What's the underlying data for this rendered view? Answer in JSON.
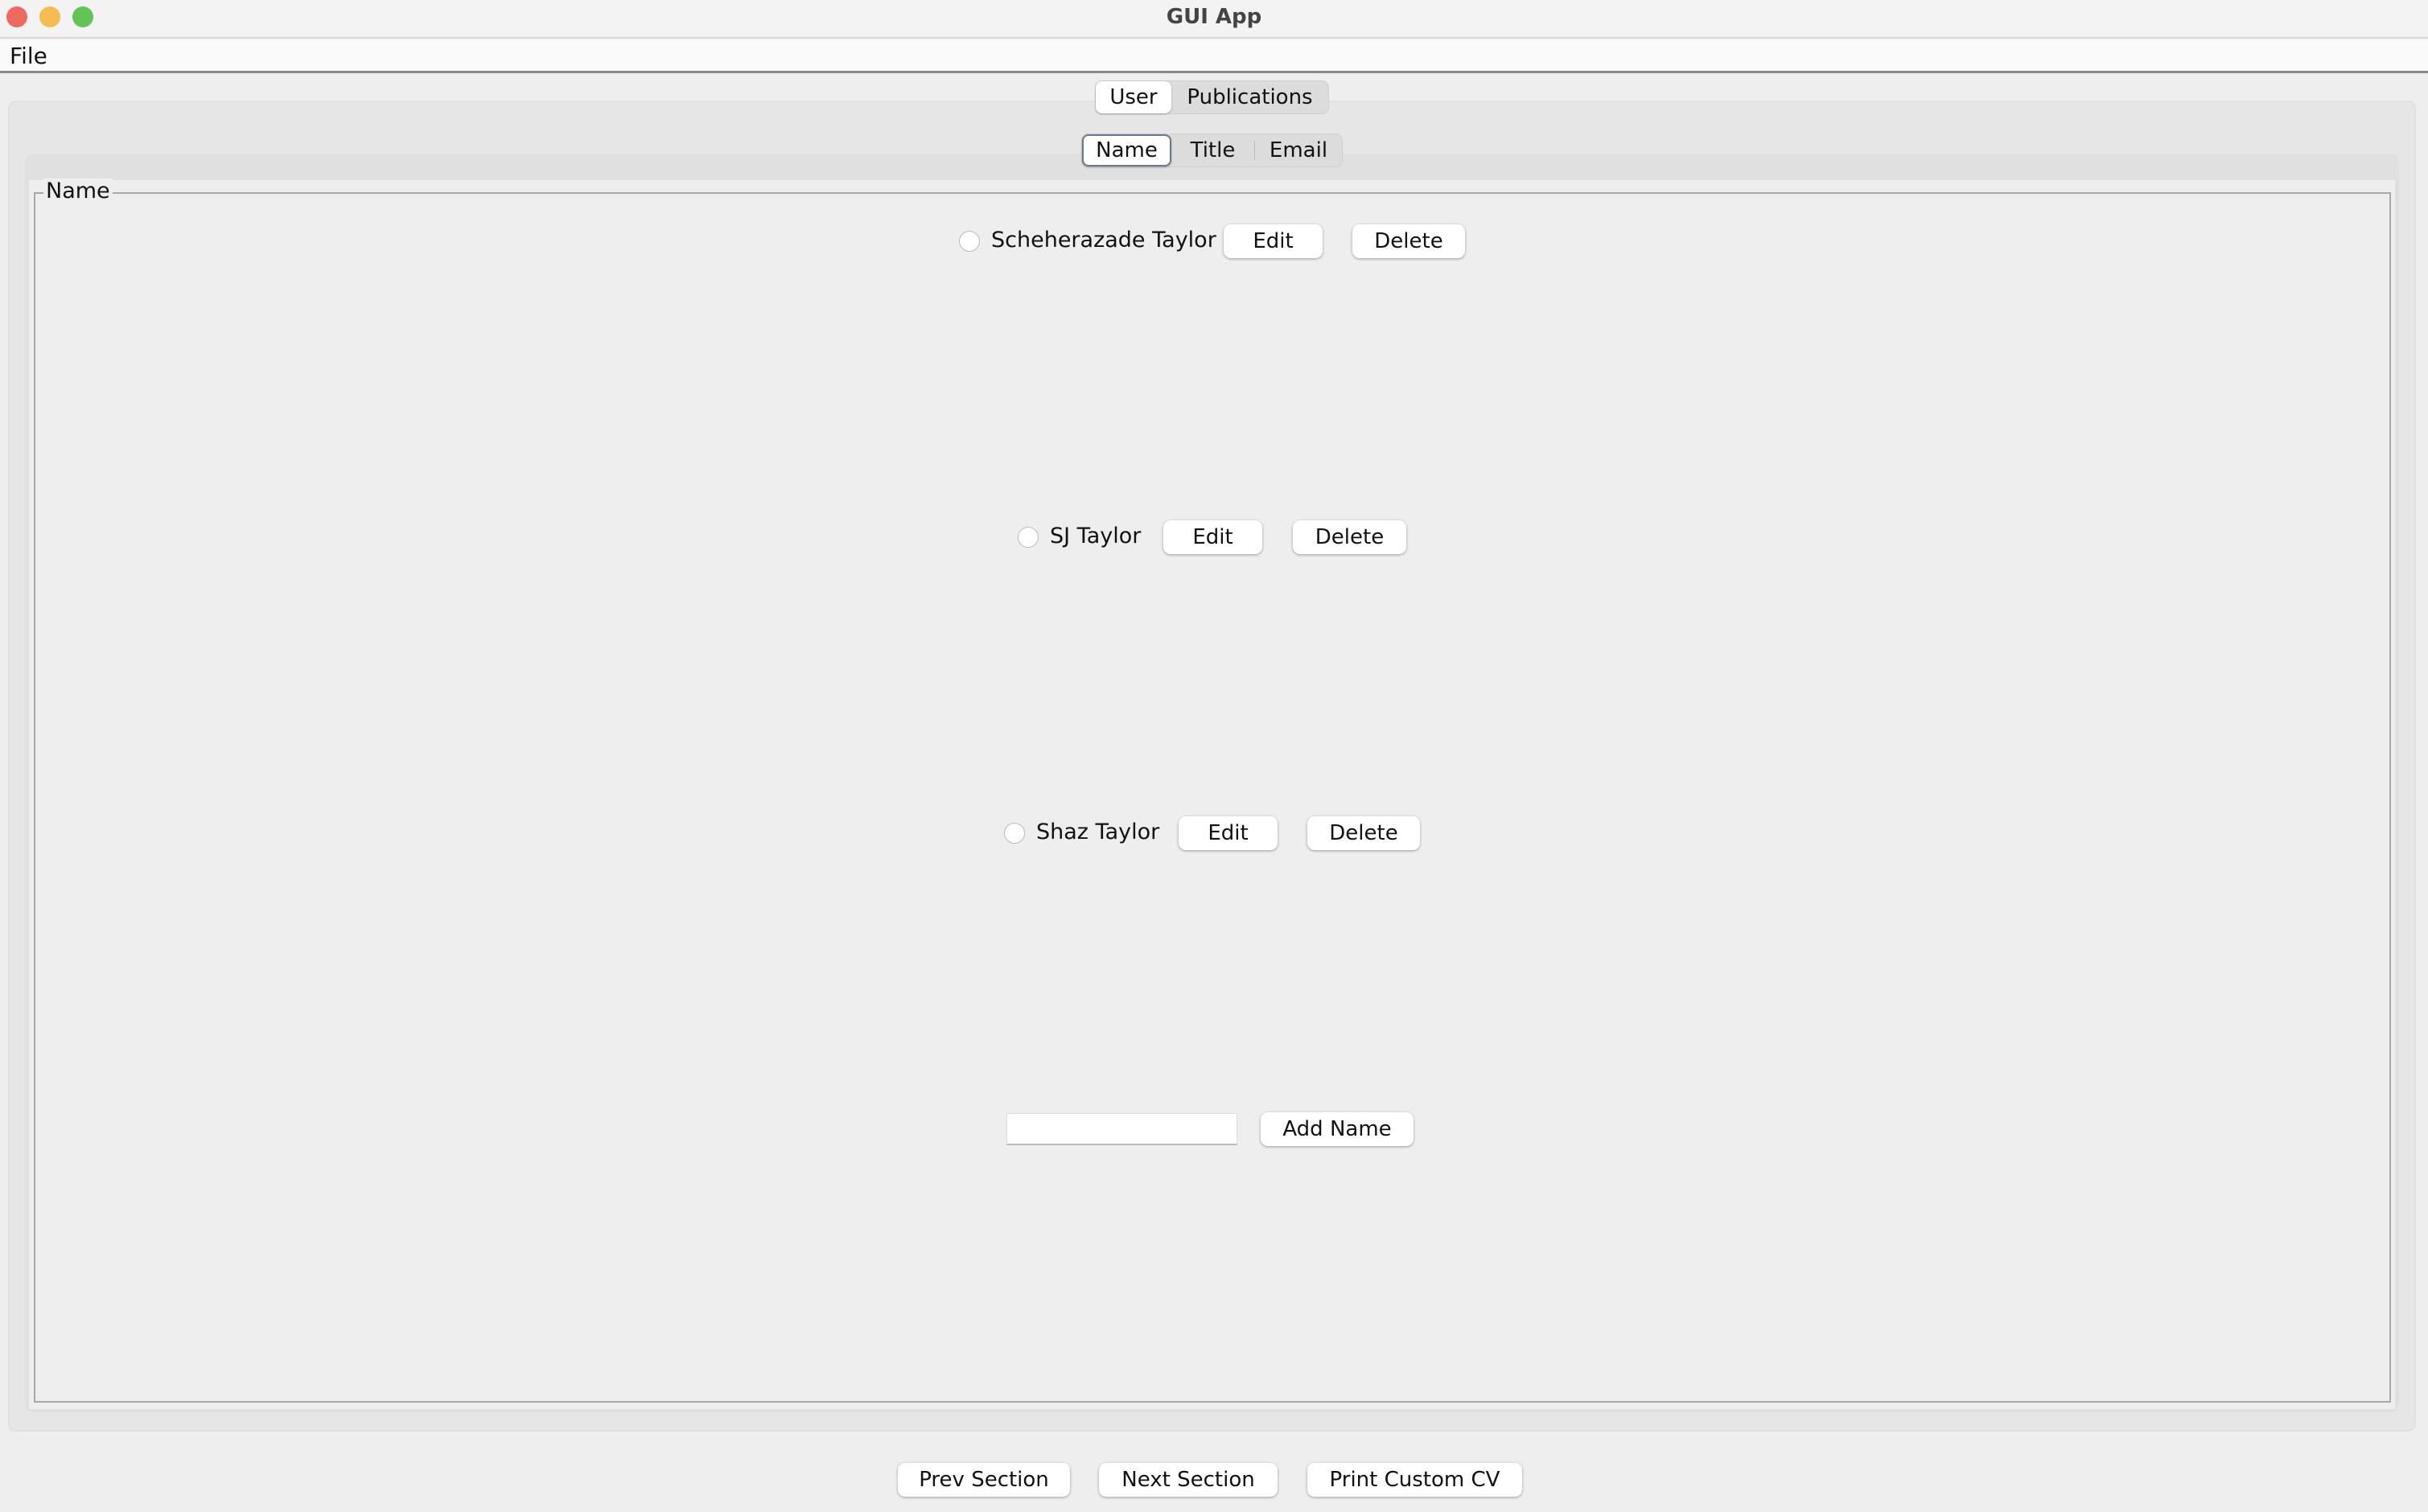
{
  "window": {
    "title": "GUI App"
  },
  "menubar": {
    "file": "File"
  },
  "top_tabs": [
    {
      "label": "User",
      "selected": true
    },
    {
      "label": "Publications",
      "selected": false
    }
  ],
  "sub_tabs": [
    {
      "label": "Name",
      "selected": true
    },
    {
      "label": "Title",
      "selected": false
    },
    {
      "label": "Email",
      "selected": false
    }
  ],
  "section": {
    "legend": "Name",
    "entries": [
      {
        "name": "Scheherazade Taylor",
        "selected": false,
        "edit": "Edit",
        "delete": "Delete"
      },
      {
        "name": "SJ Taylor",
        "selected": false,
        "edit": "Edit",
        "delete": "Delete"
      },
      {
        "name": "Shaz Taylor",
        "selected": false,
        "edit": "Edit",
        "delete": "Delete"
      }
    ],
    "add_input": {
      "value": "",
      "placeholder": ""
    },
    "add_button": "Add Name"
  },
  "footer": {
    "prev": "Prev Section",
    "next": "Next Section",
    "print": "Print Custom CV"
  },
  "colors": {
    "close": "#ee6a5f",
    "minimize": "#f5bd4f",
    "maximize": "#61c454"
  }
}
